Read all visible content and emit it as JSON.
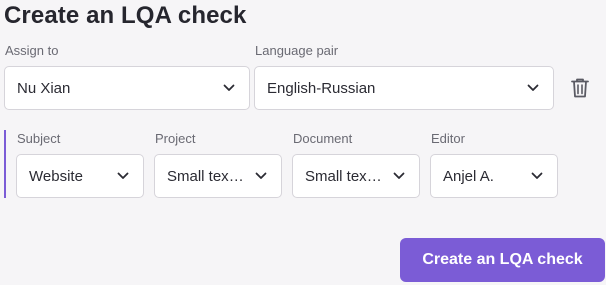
{
  "page": {
    "title": "Create an LQA check"
  },
  "assignment": {
    "assign_to_label": "Assign to",
    "assign_to_value": "Nu Xian",
    "language_pair_label": "Language pair",
    "language_pair_value": "English-Russian"
  },
  "details": {
    "subject_label": "Subject",
    "subject_value": "Website",
    "project_label": "Project",
    "project_value": "Small text ...",
    "document_label": "Document",
    "document_value": "Small text ...",
    "editor_label": "Editor",
    "editor_value": "Anjel A."
  },
  "actions": {
    "create_label": "Create an LQA check"
  },
  "icons": {
    "dropdown": "chevron-down-icon",
    "delete": "trash-icon"
  },
  "colors": {
    "accent": "#7b5cd6",
    "background": "#f6f5f7",
    "field_border": "#d6d4da"
  }
}
